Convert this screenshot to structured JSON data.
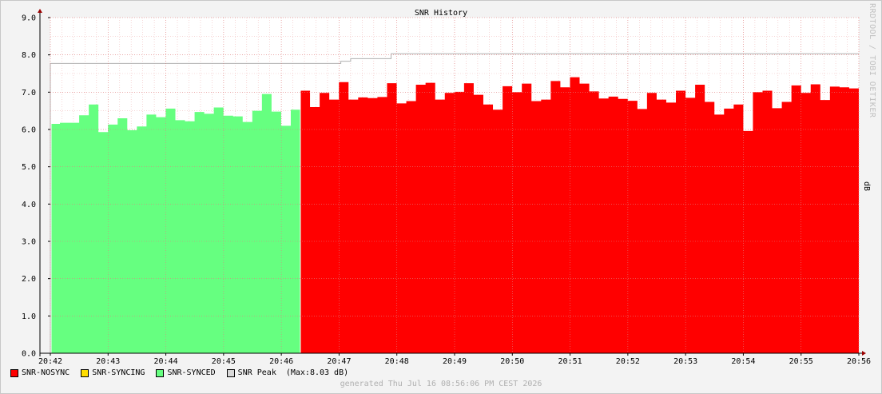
{
  "chart_data": {
    "type": "area",
    "title": "SNR History",
    "ylabel": "dB",
    "ylim": [
      0,
      9
    ],
    "yticks": [
      "0.0",
      "1.0",
      "2.0",
      "3.0",
      "4.0",
      "5.0",
      "6.0",
      "7.0",
      "8.0",
      "9.0"
    ],
    "xlim": [
      0,
      14
    ],
    "xticks": [
      "20:42",
      "20:43",
      "20:44",
      "20:45",
      "20:46",
      "20:47",
      "20:48",
      "20:49",
      "20:50",
      "20:51",
      "20:52",
      "20:53",
      "20:54",
      "20:55",
      "20:56"
    ],
    "grid": true,
    "synced": {
      "name": "SNR-SYNCED",
      "color": "#66ff80",
      "values": [
        6.15,
        6.18,
        6.18,
        6.38,
        6.67,
        5.93,
        6.13,
        6.3,
        5.98,
        6.08,
        6.4,
        6.33,
        6.56,
        6.25,
        6.22,
        6.47,
        6.42,
        6.59,
        6.37,
        6.35,
        6.2,
        6.5,
        6.95,
        6.48,
        6.1,
        6.53
      ]
    },
    "nosync": {
      "name": "SNR-NOSYNC",
      "color": "#ff0000",
      "values": [
        7.04,
        6.6,
        6.98,
        6.8,
        7.27,
        6.8,
        6.86,
        6.84,
        6.87,
        7.24,
        6.7,
        6.76,
        7.2,
        7.25,
        6.8,
        6.98,
        7.01,
        7.24,
        6.93,
        6.67,
        6.53,
        7.16,
        7.0,
        7.23,
        6.76,
        6.8,
        7.3,
        7.13,
        7.4,
        7.23,
        7.02,
        6.83,
        6.88,
        6.82,
        6.77,
        6.55,
        6.98,
        6.8,
        6.72,
        7.04,
        6.85,
        7.2,
        6.74,
        6.4,
        6.56,
        6.67,
        5.96,
        7.0,
        7.04,
        6.57,
        6.74,
        7.18,
        6.98,
        7.21,
        6.79,
        7.15,
        7.13,
        7.1
      ]
    },
    "peak": {
      "name": "SNR Peak",
      "color": "#b0b0b0",
      "points": [
        [
          0,
          7.77
        ],
        [
          5.03,
          7.77
        ],
        [
          5.03,
          7.83
        ],
        [
          5.2,
          7.83
        ],
        [
          5.2,
          7.9
        ],
        [
          5.9,
          7.9
        ],
        [
          5.9,
          8.03
        ],
        [
          14,
          8.03
        ]
      ]
    }
  },
  "legend": {
    "nosync": {
      "label": "SNR-NOSYNC",
      "color": "#ff0000"
    },
    "syncing": {
      "label": "SNR-SYNCING",
      "color": "#ffdd00"
    },
    "synced": {
      "label": "SNR-SYNCED",
      "color": "#66ff80"
    },
    "peak": {
      "label": "SNR Peak",
      "color": "#d8d8d8",
      "note": "(Max:8.03 dB)"
    }
  },
  "footer": "generated Thu Jul 16 08:56:06 PM CEST 2026",
  "watermark": "RRDTOOL / TOBI OETIKER"
}
